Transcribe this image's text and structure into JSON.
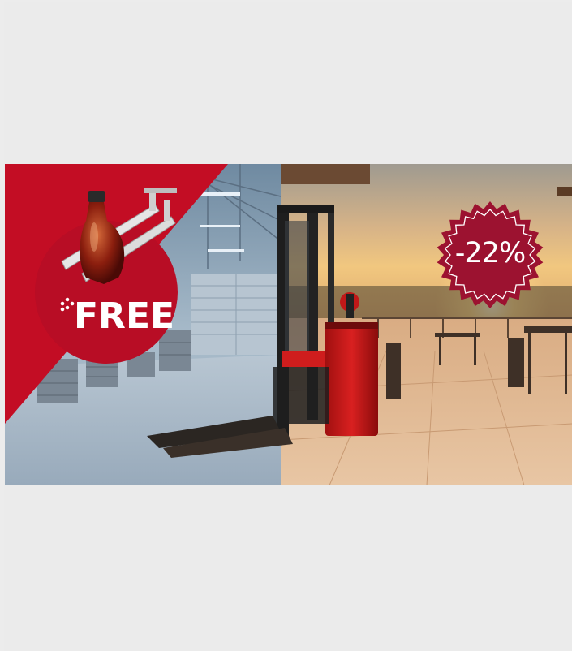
{
  "promo": {
    "free_label": "FREE",
    "discount_label": "-22%"
  },
  "colors": {
    "brand_red": "#c30d24",
    "badge_red": "#9c1230",
    "page_background": "#ececec"
  },
  "icons": {
    "sparkle": "sparkle-icon"
  }
}
